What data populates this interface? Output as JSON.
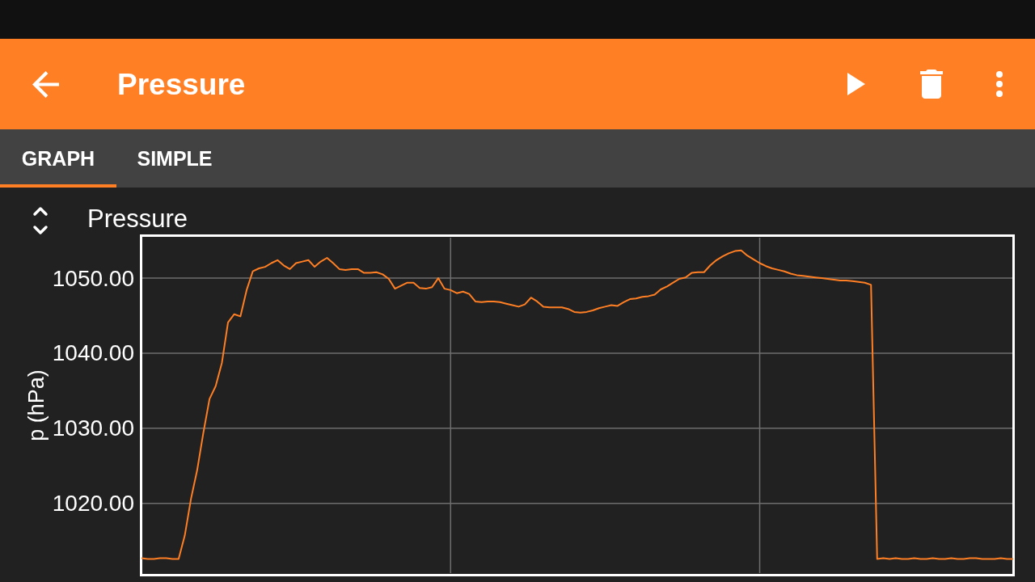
{
  "toolbar": {
    "title": "Pressure"
  },
  "tabs": [
    {
      "label": "GRAPH",
      "selected": true
    },
    {
      "label": "SIMPLE",
      "selected": false
    }
  ],
  "graph": {
    "chart_data": {
      "type": "line",
      "title": "Pressure",
      "ylabel": "p (hPa)",
      "grid": true,
      "categories": [
        null,
        null,
        null,
        null,
        null,
        null,
        null,
        null,
        null,
        null,
        null,
        null,
        null,
        null,
        null,
        null,
        null,
        null,
        null,
        null,
        null,
        null,
        null,
        null,
        null,
        null,
        null,
        null,
        null,
        null,
        null,
        null,
        null,
        null,
        null,
        null,
        null,
        null,
        null,
        null,
        null,
        null,
        null,
        null,
        null,
        null,
        null,
        null,
        null,
        null,
        null,
        null,
        null,
        null,
        null,
        null,
        null,
        null,
        null,
        null,
        null,
        null,
        null,
        null,
        null,
        null,
        null,
        null,
        null,
        null,
        null,
        null,
        null,
        null,
        null,
        null,
        null,
        null,
        null,
        null,
        null,
        null,
        null,
        null,
        null,
        null,
        null,
        null,
        null,
        null,
        null,
        null,
        null,
        null,
        null,
        null,
        null,
        null,
        null,
        null,
        null,
        null,
        null,
        null,
        null,
        null,
        null,
        null,
        null,
        null,
        null,
        null,
        null,
        null,
        null,
        null,
        null,
        null,
        null,
        null,
        null,
        null,
        null,
        null,
        null,
        null,
        null,
        null,
        null,
        null,
        null,
        null,
        null,
        null,
        null,
        null,
        null,
        null,
        null,
        null,
        null,
        null
      ],
      "series": [
        {
          "color": "#ff7f24",
          "values": [
            1012.7,
            1012.6,
            1012.6,
            1012.7,
            1012.7,
            1012.6,
            1012.6,
            1015.7,
            1020.6,
            1024.4,
            1029.4,
            1033.9,
            1035.6,
            1038.7,
            1044.1,
            1045.2,
            1044.9,
            1048.4,
            1050.9,
            1051.3,
            1051.5,
            1052.0,
            1052.4,
            1051.7,
            1051.2,
            1052.0,
            1052.2,
            1052.4,
            1051.5,
            1052.2,
            1052.7,
            1052.0,
            1051.2,
            1051.1,
            1051.2,
            1051.2,
            1050.7,
            1050.7,
            1050.8,
            1050.5,
            1049.9,
            1048.6,
            1049.0,
            1049.4,
            1049.4,
            1048.7,
            1048.6,
            1048.8,
            1050.0,
            1048.6,
            1048.4,
            1048.0,
            1048.2,
            1047.9,
            1046.9,
            1046.8,
            1046.9,
            1046.9,
            1046.8,
            1046.6,
            1046.4,
            1046.2,
            1046.5,
            1047.4,
            1046.9,
            1046.2,
            1046.1,
            1046.1,
            1046.1,
            1045.9,
            1045.5,
            1045.4,
            1045.5,
            1045.7,
            1046.0,
            1046.2,
            1046.4,
            1046.3,
            1046.8,
            1047.2,
            1047.3,
            1047.5,
            1047.6,
            1047.8,
            1048.5,
            1048.9,
            1049.4,
            1049.9,
            1050.1,
            1050.7,
            1050.8,
            1050.8,
            1051.7,
            1052.4,
            1052.9,
            1053.3,
            1053.6,
            1053.7,
            1053.0,
            1052.5,
            1052.0,
            1051.6,
            1051.3,
            1051.1,
            1050.9,
            1050.6,
            1050.4,
            1050.3,
            1050.2,
            1050.1,
            1050.0,
            1049.9,
            1049.8,
            1049.7,
            1049.7,
            1049.6,
            1049.5,
            1049.4,
            1049.1,
            1012.6,
            1012.7,
            1012.6,
            1012.7,
            1012.6,
            1012.6,
            1012.7,
            1012.6,
            1012.6,
            1012.7,
            1012.6,
            1012.6,
            1012.7,
            1012.6,
            1012.6,
            1012.7,
            1012.7,
            1012.6,
            1012.6,
            1012.6,
            1012.7,
            1012.6,
            1012.6
          ]
        }
      ],
      "ylim": [
        1010.6,
        1055.5
      ],
      "yticks": [
        {
          "value": 1020,
          "label": "1020.00"
        },
        {
          "value": 1030,
          "label": "1030.00"
        },
        {
          "value": 1040,
          "label": "1040.00"
        },
        {
          "value": 1050,
          "label": "1050.00"
        }
      ]
    }
  }
}
